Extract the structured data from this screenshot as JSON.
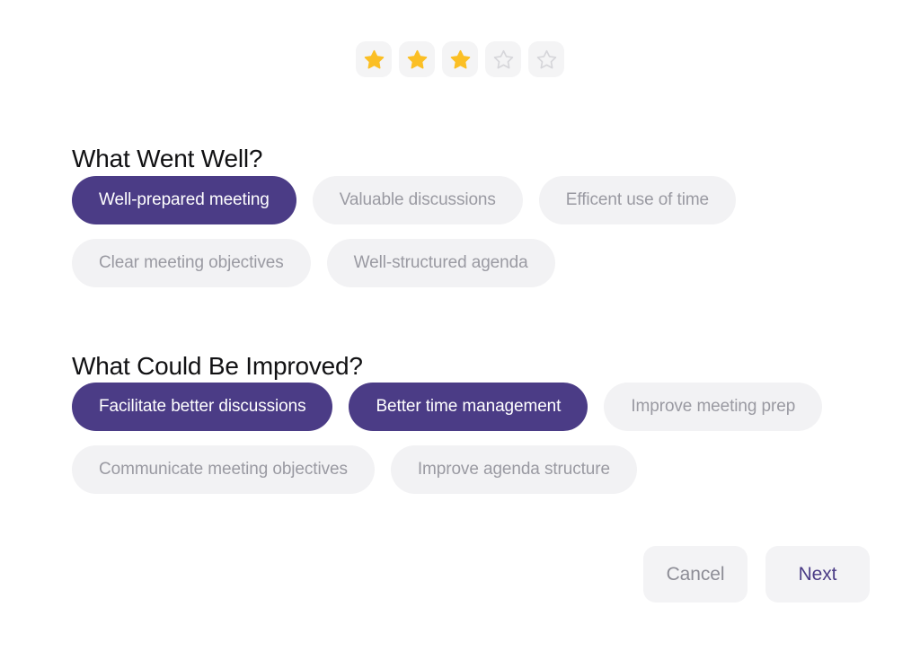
{
  "rating": {
    "name": "star-rating",
    "value": 3,
    "max": 5,
    "filled_color": "#fbbf24",
    "empty_color": "#d6d6da",
    "tile_bg": "#f4f4f5"
  },
  "sections": [
    {
      "id": "went-well",
      "title": "What Went Well?",
      "options": [
        {
          "label": "Well-prepared meeting",
          "selected": true
        },
        {
          "label": "Valuable discussions",
          "selected": false
        },
        {
          "label": "Efficent use of time",
          "selected": false
        },
        {
          "label": "Clear meeting objectives",
          "selected": false
        },
        {
          "label": "Well-structured agenda",
          "selected": false
        }
      ]
    },
    {
      "id": "improved",
      "title": "What Could Be Improved?",
      "options": [
        {
          "label": "Facilitate better discussions",
          "selected": true
        },
        {
          "label": "Better time management",
          "selected": true
        },
        {
          "label": "Improve meeting prep",
          "selected": false
        },
        {
          "label": "Communicate meeting objectives",
          "selected": false
        },
        {
          "label": "Improve agenda structure",
          "selected": false
        }
      ]
    }
  ],
  "footer": {
    "cancel_label": "Cancel",
    "next_label": "Next"
  },
  "colors": {
    "accent_purple": "#4b3c86",
    "chip_unselected_bg": "#f2f2f4",
    "chip_unselected_text": "#9a9aa2",
    "star_gold": "#fbbf24",
    "card_bg": "#ffffff"
  }
}
